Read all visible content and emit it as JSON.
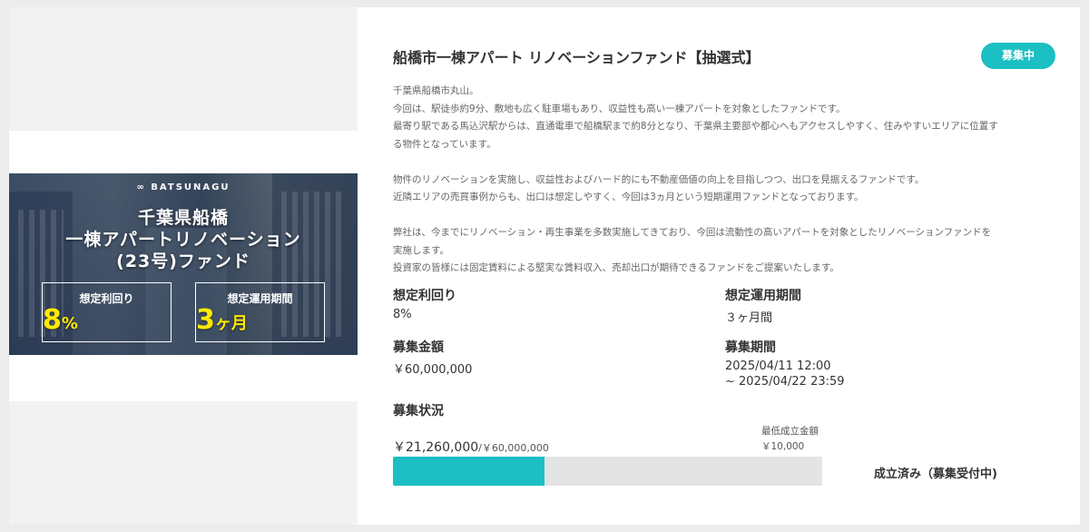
{
  "banner": {
    "brand": "∞ BATSUNAGU",
    "title_line1": "千葉県船橋",
    "title_line2": "一棟アパートリノベーション",
    "title_line3": "(23号)ファンド",
    "yield_label": "想定利回り",
    "yield_value": "8",
    "yield_unit": "%",
    "period_label": "想定運用期間",
    "period_value": "3",
    "period_unit": "ヶ月"
  },
  "fund": {
    "title": "船橋市一棟アパート リノベーションファンド【抽選式】",
    "badge": "募集中",
    "description": {
      "p1": "千葉県船橋市丸山。",
      "p2": "今回は、駅徒歩約9分、敷地も広く駐車場もあり、収益性も高い一棟アパートを対象としたファンドです。",
      "p3": "最寄り駅である馬込沢駅からは、直通電車で船橋駅まで約8分となり、千葉県主要部や都心へもアクセスしやすく、住みやすいエリアに位置す",
      "p4": "る物件となっています。",
      "p5": "物件のリノベーションを実施し、収益性およびハード的にも不動産価値の向上を目指しつつ、出口を見据えるファンドです。",
      "p6": "近隣エリアの売買事例からも、出口は想定しやすく、今回は3ヵ月という短期運用ファンドとなっております。",
      "p7": "弊社は、今までにリノベーション・再生事業を多数実施してきており、今回は流動性の高いアパートを対象としたリノベーションファンドを",
      "p8": "実施します。",
      "p9": "投資家の皆様には固定賃料による堅実な賃料収入、売却出口が期待できるファンドをご提案いたします。"
    },
    "yield_label": "想定利回り",
    "yield_value": "8%",
    "period_label": "想定運用期間",
    "period_value": "３ヶ月間",
    "amount_label": "募集金額",
    "amount_value": "￥60,000,000",
    "recruit_period_label": "募集期間",
    "recruit_period_start": "2025/04/11 12:00",
    "recruit_period_end": "~ 2025/04/22 23:59",
    "status_label": "募集状況",
    "min_label": "最低成立金額",
    "min_value": "￥10,000",
    "raised": "￥21,260,000",
    "raised_total": "/￥60,000,000",
    "progress_fraction": 0.354,
    "completion_status": "成立済み（募集受付中)"
  },
  "colors": {
    "accent": "#1bbfc4",
    "bar_track": "#e4e4e4",
    "highlight": "#ffea00"
  }
}
